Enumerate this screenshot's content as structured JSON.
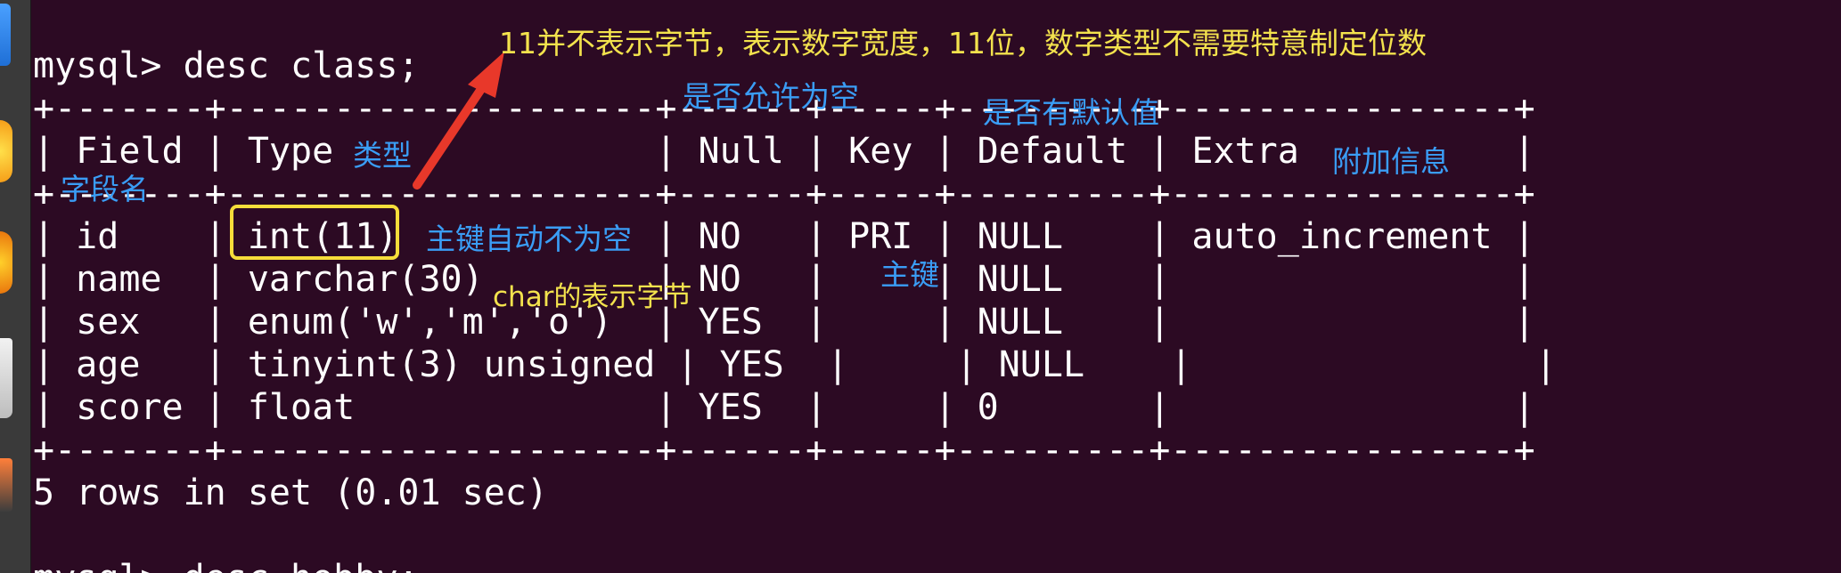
{
  "terminal": {
    "prompt_line": "mysql> desc class;",
    "border_line": "+-------+--------------------+------+-----+---------+----------------+",
    "header_line": "| Field | Type               | Null | Key | Default | Extra          |",
    "rows": [
      "| id    | int(11)            | NO   | PRI | NULL    | auto_increment |",
      "| name  | varchar(30)        | NO   |     | NULL    |                |",
      "| sex   | enum('w','m','o')  | YES  |     | NULL    |                |",
      "| age   | tinyint(3) unsigned | YES  |     | NULL    |                |",
      "| score | float              | YES  |     | 0       |                |"
    ],
    "result_line": "5 rows in set (0.01 sec)",
    "next_prompt_line": "mysql> desc hobby;"
  },
  "annotations": {
    "int_width_note": "11并不表示字节，表示数字宽度，11位，数字类型不需要特意制定位数",
    "null_note": "是否允许为空",
    "default_note": "是否有默认值",
    "type_note": "类型",
    "extra_note": "附加信息",
    "field_note": "字段名",
    "pk_not_null_note": "主键自动不为空",
    "char_note": "char的表示字节",
    "pri_note": "主键"
  },
  "colors": {
    "background": "#2c0a23",
    "terminal_text": "#ffffff",
    "annotation_yellow": "#f3e24d",
    "annotation_blue": "#3a9df5",
    "arrow_red": "#e8382a",
    "highlight_box": "#f6dd3a"
  }
}
